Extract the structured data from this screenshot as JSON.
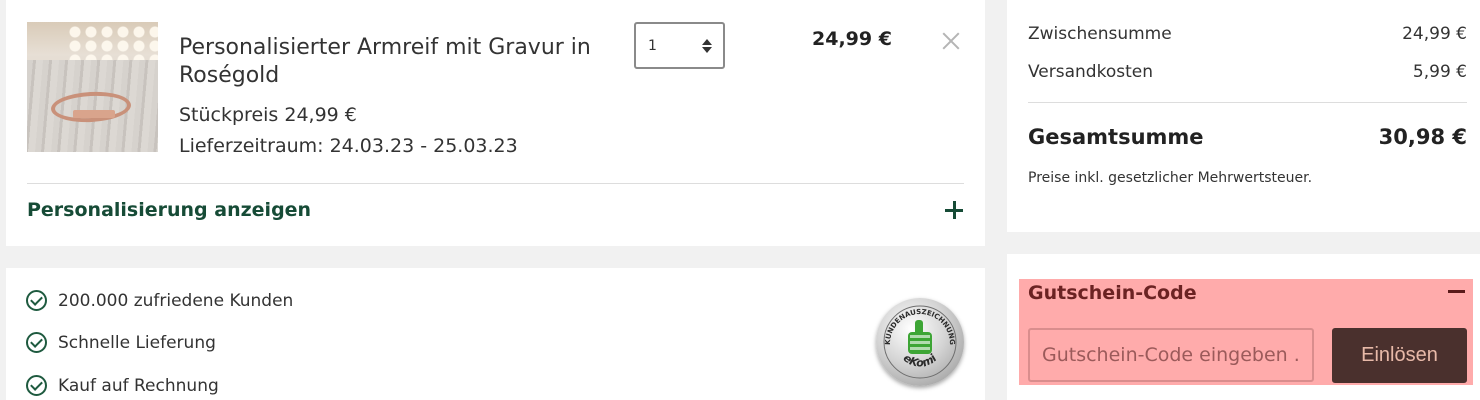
{
  "cart_item": {
    "title": "Personalisierter Armreif mit Gravur in Roségold",
    "unit_price": "Stückpreis 24,99 €",
    "delivery": "Lieferzeitraum: 24.03.23 - 25.03.23",
    "quantity": "1",
    "line_price": "24,99 €",
    "personalize_label": "Personalisierung anzeigen"
  },
  "trust": {
    "items": [
      "200.000 zufriedene Kunden",
      "Schnelle Lieferung",
      "Kauf auf Rechnung"
    ],
    "seal_top": "KUNDENAUSZEICHNUNG",
    "seal_bottom": "eKomi"
  },
  "summary": {
    "subtotal_label": "Zwischensumme",
    "subtotal_value": "24,99 €",
    "shipping_label": "Versandkosten",
    "shipping_value": "5,99 €",
    "total_label": "Gesamtsumme",
    "total_value": "30,98 €",
    "vat_note": "Preise inkl. gesetzlicher Mehrwertsteuer."
  },
  "voucher": {
    "title": "Gutschein-Code",
    "placeholder": "Gutschein-Code eingeben ...",
    "button_label": "Einlösen"
  },
  "colors": {
    "brand_green": "#164b36",
    "highlight_pink": "#ffabab",
    "button_brown": "#4a302d"
  }
}
